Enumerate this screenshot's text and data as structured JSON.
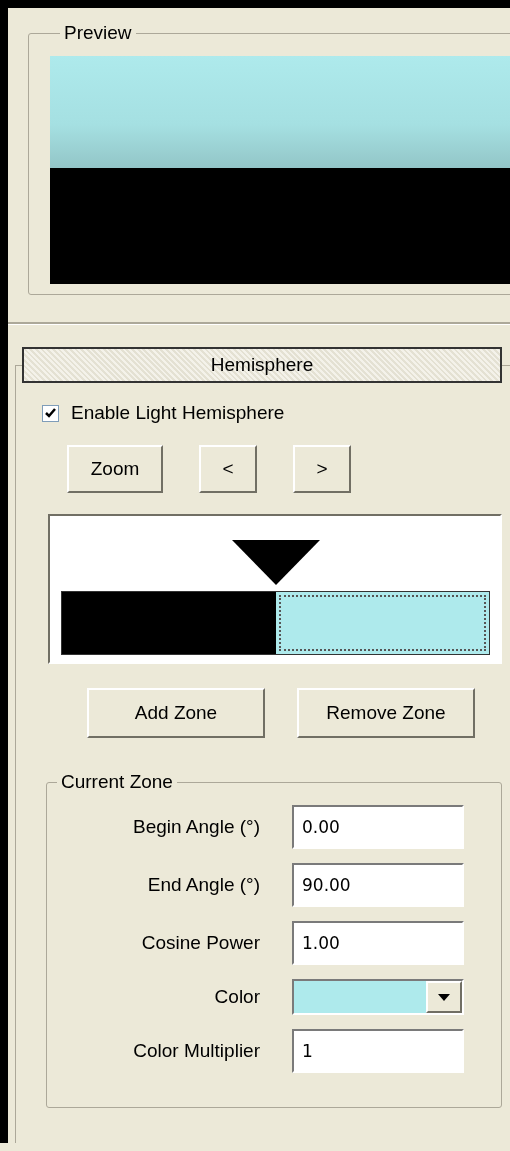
{
  "preview": {
    "title": "Preview"
  },
  "rollout": {
    "title": "Hemisphere"
  },
  "enable_checkbox": {
    "label": "Enable Light Hemisphere",
    "checked": true
  },
  "view_buttons": [
    "Zoom",
    "<",
    ">"
  ],
  "zones": [
    {
      "color": "#000000",
      "selected": false
    },
    {
      "color": "#aeeaec",
      "selected": true
    }
  ],
  "zone_buttons": [
    "Add Zone",
    "Remove Zone"
  ],
  "current_zone": {
    "title": "Current Zone",
    "fields": [
      {
        "kind": "text",
        "label": "Begin Angle (°)",
        "value": "0.00"
      },
      {
        "kind": "text",
        "label": "End Angle (°)",
        "value": "90.00"
      },
      {
        "kind": "text",
        "label": "Cosine Power",
        "value": "1.00"
      },
      {
        "kind": "color",
        "label": "Color",
        "color": "#aeeaec"
      },
      {
        "kind": "text",
        "label": "Color Multiplier",
        "value": "1"
      }
    ]
  }
}
